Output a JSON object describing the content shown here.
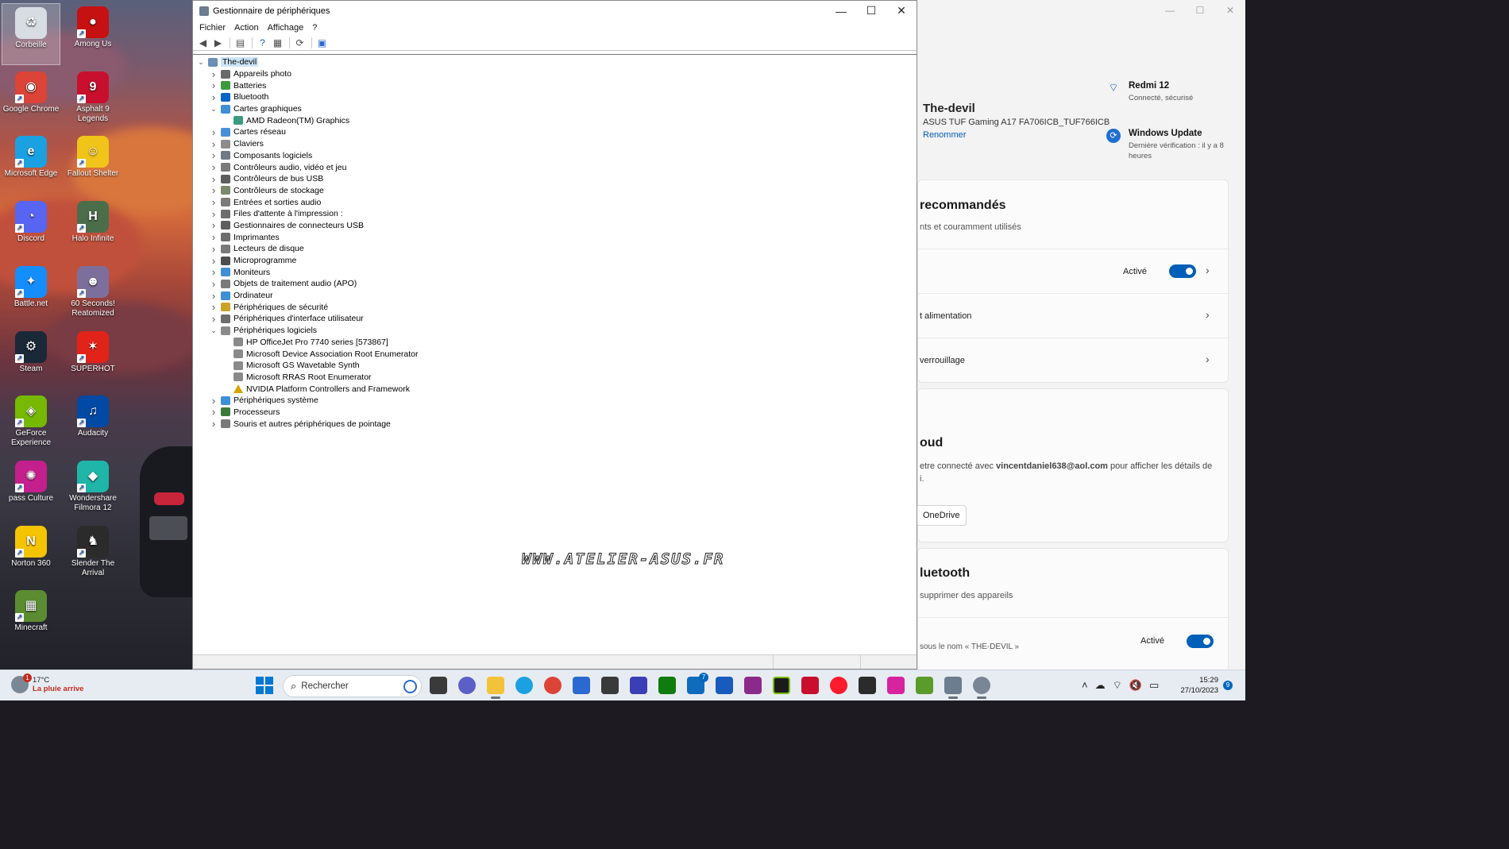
{
  "desktop": {
    "icons": [
      {
        "label": "Corbeille",
        "icon": "recycle-bin-icon",
        "color": "#d7dde3",
        "glyph": "♻"
      },
      {
        "label": "Among Us",
        "icon": "among-us-icon",
        "color": "#c51111",
        "glyph": "●"
      },
      {
        "label": "Google Chrome",
        "icon": "chrome-icon",
        "color": "#db4437",
        "glyph": "◉"
      },
      {
        "label": "Asphalt 9 Legends",
        "icon": "asphalt-icon",
        "color": "#c8102e",
        "glyph": "9"
      },
      {
        "label": "Microsoft Edge",
        "icon": "edge-icon",
        "color": "#1ba1e2",
        "glyph": "e"
      },
      {
        "label": "Fallout Shelter",
        "icon": "fallout-shelter-icon",
        "color": "#f0c419",
        "glyph": "☺"
      },
      {
        "label": "Discord",
        "icon": "discord-icon",
        "color": "#5865f2",
        "glyph": "◔"
      },
      {
        "label": "Halo Infinite",
        "icon": "halo-icon",
        "color": "#4c6d4a",
        "glyph": "H"
      },
      {
        "label": "Battle.net",
        "icon": "battlenet-icon",
        "color": "#148eff",
        "glyph": "✦"
      },
      {
        "label": "60 Seconds! Reatomized",
        "icon": "sixty-seconds-icon",
        "color": "#7d6f9b",
        "glyph": "☻"
      },
      {
        "label": "Steam",
        "icon": "steam-icon",
        "color": "#1b2838",
        "glyph": "⚙"
      },
      {
        "label": "SUPERHOT",
        "icon": "superhot-icon",
        "color": "#e2231a",
        "glyph": "✶"
      },
      {
        "label": "GeForce Experience",
        "icon": "geforce-icon",
        "color": "#76b900",
        "glyph": "◈"
      },
      {
        "label": "Audacity",
        "icon": "audacity-icon",
        "color": "#0049a5",
        "glyph": "♫"
      },
      {
        "label": "pass Culture",
        "icon": "pass-culture-icon",
        "color": "#c4208d",
        "glyph": "✺"
      },
      {
        "label": "Wondershare Filmora 12",
        "icon": "filmora-icon",
        "color": "#1fb5a8",
        "glyph": "◆"
      },
      {
        "label": "Norton 360",
        "icon": "norton-icon",
        "color": "#f5c400",
        "glyph": "N"
      },
      {
        "label": "Slender The Arrival",
        "icon": "slender-icon",
        "color": "#2b2b2b",
        "glyph": "♞"
      },
      {
        "label": "Minecraft",
        "icon": "minecraft-icon",
        "color": "#5b8c32",
        "glyph": "▦"
      }
    ]
  },
  "device_manager": {
    "title": "Gestionnaire de périphériques",
    "menu": [
      "Fichier",
      "Action",
      "Affichage",
      "?"
    ],
    "tree": [
      {
        "label": "The-devil",
        "level": 0,
        "exp": "v",
        "icon_color": "#6b8fb5",
        "root": true
      },
      {
        "label": "Appareils photo",
        "level": 1,
        "exp": ">",
        "icon_color": "#6a6a6a"
      },
      {
        "label": "Batteries",
        "level": 1,
        "exp": ">",
        "icon_color": "#3c9a3c"
      },
      {
        "label": "Bluetooth",
        "level": 1,
        "exp": ">",
        "icon_color": "#0a64c8"
      },
      {
        "label": "Cartes graphiques",
        "level": 1,
        "exp": "v",
        "icon_color": "#3e8fd6"
      },
      {
        "label": "AMD Radeon(TM) Graphics",
        "level": 2,
        "exp": "",
        "icon_color": "#3a9a82"
      },
      {
        "label": "Cartes réseau",
        "level": 1,
        "exp": ">",
        "icon_color": "#4a90d9"
      },
      {
        "label": "Claviers",
        "level": 1,
        "exp": ">",
        "icon_color": "#8c8c8c"
      },
      {
        "label": "Composants logiciels",
        "level": 1,
        "exp": ">",
        "icon_color": "#707a86"
      },
      {
        "label": "Contrôleurs audio, vidéo et jeu",
        "level": 1,
        "exp": ">",
        "icon_color": "#7a7a7a"
      },
      {
        "label": "Contrôleurs de bus USB",
        "level": 1,
        "exp": ">",
        "icon_color": "#5d5d5d"
      },
      {
        "label": "Contrôleurs de stockage",
        "level": 1,
        "exp": ">",
        "icon_color": "#7a8a6a"
      },
      {
        "label": "Entrées et sorties audio",
        "level": 1,
        "exp": ">",
        "icon_color": "#7a7a7a"
      },
      {
        "label": "Files d'attente à l'impression :",
        "level": 1,
        "exp": ">",
        "icon_color": "#6d6d6d"
      },
      {
        "label": "Gestionnaires de connecteurs USB",
        "level": 1,
        "exp": ">",
        "icon_color": "#5d5d5d"
      },
      {
        "label": "Imprimantes",
        "level": 1,
        "exp": ">",
        "icon_color": "#6d6d6d"
      },
      {
        "label": "Lecteurs de disque",
        "level": 1,
        "exp": ">",
        "icon_color": "#7a7a7a"
      },
      {
        "label": "Microprogramme",
        "level": 1,
        "exp": ">",
        "icon_color": "#4e4e4e"
      },
      {
        "label": "Moniteurs",
        "level": 1,
        "exp": ">",
        "icon_color": "#3e8fd6"
      },
      {
        "label": "Objets de traitement audio (APO)",
        "level": 1,
        "exp": ">",
        "icon_color": "#7a7a7a"
      },
      {
        "label": "Ordinateur",
        "level": 1,
        "exp": ">",
        "icon_color": "#3e8fd6"
      },
      {
        "label": "Périphériques de sécurité",
        "level": 1,
        "exp": ">",
        "icon_color": "#c9a227"
      },
      {
        "label": "Périphériques d'interface utilisateur",
        "level": 1,
        "exp": ">",
        "icon_color": "#6d6d6d"
      },
      {
        "label": "Périphériques logiciels",
        "level": 1,
        "exp": "v",
        "icon_color": "#8a8a8a"
      },
      {
        "label": "HP OfficeJet Pro 7740 series [573867]",
        "level": 2,
        "exp": "",
        "icon_color": "#8a8a8a"
      },
      {
        "label": "Microsoft Device Association Root Enumerator",
        "level": 2,
        "exp": "",
        "icon_color": "#8a8a8a"
      },
      {
        "label": "Microsoft GS Wavetable Synth",
        "level": 2,
        "exp": "",
        "icon_color": "#8a8a8a"
      },
      {
        "label": "Microsoft RRAS Root Enumerator",
        "level": 2,
        "exp": "",
        "icon_color": "#8a8a8a"
      },
      {
        "label": "NVIDIA Platform Controllers and Framework",
        "level": 2,
        "exp": "",
        "icon_color": "#d9a400",
        "warning": true
      },
      {
        "label": "Périphériques système",
        "level": 1,
        "exp": ">",
        "icon_color": "#3e8fd6"
      },
      {
        "label": "Processeurs",
        "level": 1,
        "exp": ">",
        "icon_color": "#3c7a3c"
      },
      {
        "label": "Souris et autres périphériques de pointage",
        "level": 1,
        "exp": ">",
        "icon_color": "#7a7a7a"
      }
    ],
    "watermark": "WWW.ATELIER-ASUS.FR"
  },
  "settings": {
    "device_name": "The-devil",
    "device_model": "ASUS TUF Gaming A17 FA706ICB_TUF766ICB",
    "rename": "Renommer",
    "wifi_title": "Redmi 12",
    "wifi_sub": "Connecté, sécurisé",
    "wu_title": "Windows Update",
    "wu_sub": "Dernière vérification : il y a 8 heures",
    "card1": {
      "heading": "recommandés",
      "sub": "nts et couramment utilisés",
      "row1_state": "Activé",
      "row2": "t alimentation",
      "row3": "verrouillage"
    },
    "card2": {
      "heading": "oud",
      "sub_pre": "etre connecté avec ",
      "email": "vincentdaniel638@aol.com",
      "sub_post": " pour afficher les détails de",
      "sub2": "i.",
      "button": "OneDrive"
    },
    "card3": {
      "heading": "luetooth",
      "sub": "supprimer des appareils",
      "row_label": "sous le nom « THE-DEVIL »",
      "state": "Activé"
    }
  },
  "taskbar": {
    "weather_temp": "17°C",
    "weather_cond": "La pluie arrive",
    "weather_badge": "1",
    "search_placeholder": "Rechercher",
    "time": "15:29",
    "date": "27/10/2023",
    "notifications": "9",
    "teams_badge": "7"
  }
}
